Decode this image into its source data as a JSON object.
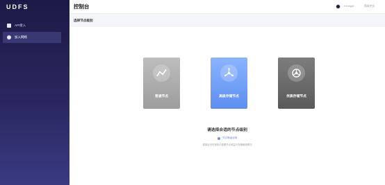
{
  "sidebar": {
    "logo": "UDFS",
    "items": [
      {
        "label": "API接入",
        "icon": "api-icon"
      },
      {
        "label": "加入网络",
        "icon": "network-icon"
      }
    ]
  },
  "header": {
    "title": "控制台",
    "user": "Hi bright",
    "language": "简体中文"
  },
  "subbar": {
    "title": "选择节点级别"
  },
  "main": {
    "cards": [
      {
        "label": "普通节点",
        "icon": "chart-line-icon"
      },
      {
        "label": "高级存储节点",
        "icon": "network-hub-icon"
      },
      {
        "label": "优质存储节点",
        "icon": "aperture-icon"
      }
    ],
    "prompt": "请选择合适的节点级别",
    "tip": "节点等级说明",
    "description": "选择后可在钱包中查看节点收益与存储使用情况"
  },
  "colors": {
    "sidebar": "#1c1a45",
    "accent": "#6f92d9",
    "card_blue": "#8bb4ff",
    "card_gray": "#9d9d9d",
    "card_dark": "#5a5a5a"
  }
}
